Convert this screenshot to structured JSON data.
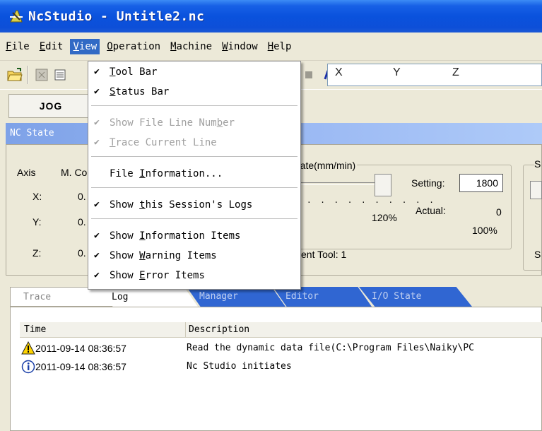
{
  "window": {
    "title": "NcStudio - Untitle2.nc"
  },
  "menubar": {
    "items": [
      {
        "pre": "",
        "key": "F",
        "post": "ile"
      },
      {
        "pre": "",
        "key": "E",
        "post": "dit"
      },
      {
        "pre": "",
        "key": "V",
        "post": "iew"
      },
      {
        "pre": "",
        "key": "O",
        "post": "peration"
      },
      {
        "pre": "",
        "key": "M",
        "post": "achine"
      },
      {
        "pre": "",
        "key": "W",
        "post": "indow"
      },
      {
        "pre": "",
        "key": "H",
        "post": "elp"
      }
    ]
  },
  "toolbar": {
    "axis_labels": [
      "X",
      "Y",
      "Z"
    ]
  },
  "jog_tab": {
    "label": "JOG"
  },
  "nc_state": {
    "header": "NC State",
    "axis_col": "Axis",
    "mc_col": "M. Co",
    "rows": [
      {
        "axis": "X:",
        "val": "0."
      },
      {
        "axis": "Y:",
        "val": "0."
      },
      {
        "axis": "Z:",
        "val": "0."
      }
    ],
    "feedrate_label": "rate(mm/min)",
    "setting_label": "Setting:",
    "setting_value": "1800",
    "actual_label": "Actual:",
    "actual_value": "0",
    "pct_slider": "120%",
    "pct_actual": "100%",
    "current_tool": "ent Tool: 1",
    "right_s1": "S",
    "right_s2": "S"
  },
  "view_menu": {
    "items": [
      {
        "checked": true,
        "disabled": false,
        "pre": "",
        "key": "T",
        "post": "ool Bar"
      },
      {
        "checked": true,
        "disabled": false,
        "pre": "",
        "key": "S",
        "post": "tatus Bar"
      },
      {
        "checked": true,
        "disabled": true,
        "pre": "Show File Line Num",
        "key": "b",
        "post": "er"
      },
      {
        "checked": true,
        "disabled": true,
        "pre": "",
        "key": "T",
        "post": "race Current Line"
      },
      {
        "checked": false,
        "disabled": false,
        "pre": "File ",
        "key": "I",
        "post": "nformation..."
      },
      {
        "checked": true,
        "disabled": false,
        "pre": "Show ",
        "key": "t",
        "post": "his Session's Logs"
      },
      {
        "checked": true,
        "disabled": false,
        "pre": "Show ",
        "key": "I",
        "post": "nformation Items"
      },
      {
        "checked": true,
        "disabled": false,
        "pre": "Show ",
        "key": "W",
        "post": "arning Items"
      },
      {
        "checked": true,
        "disabled": false,
        "pre": "Show ",
        "key": "E",
        "post": "rror Items"
      }
    ]
  },
  "lower_tabs": [
    "Trace",
    "Log",
    "Manager",
    "Editor",
    "I/O State"
  ],
  "log": {
    "columns": [
      "Time",
      "Description"
    ],
    "rows": [
      {
        "icon": "warning-icon",
        "time": "2011-09-14 08:36:57",
        "desc": "Read the dynamic data file(C:\\Program Files\\Naiky\\PC"
      },
      {
        "icon": "info-icon",
        "time": "2011-09-14 08:36:57",
        "desc": "Nc Studio initiates"
      }
    ]
  }
}
